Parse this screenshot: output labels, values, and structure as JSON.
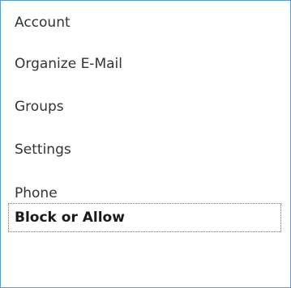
{
  "nav": {
    "items": [
      {
        "label": "Account"
      },
      {
        "label": "Organize E-Mail"
      },
      {
        "label": "Groups"
      },
      {
        "label": "Settings"
      },
      {
        "label": "Phone"
      },
      {
        "label": "Block or Allow",
        "selected": true
      }
    ]
  },
  "colors": {
    "panel_border": "#5b9bd5",
    "text": "#333333",
    "focus_border": "#6e6e6e"
  }
}
